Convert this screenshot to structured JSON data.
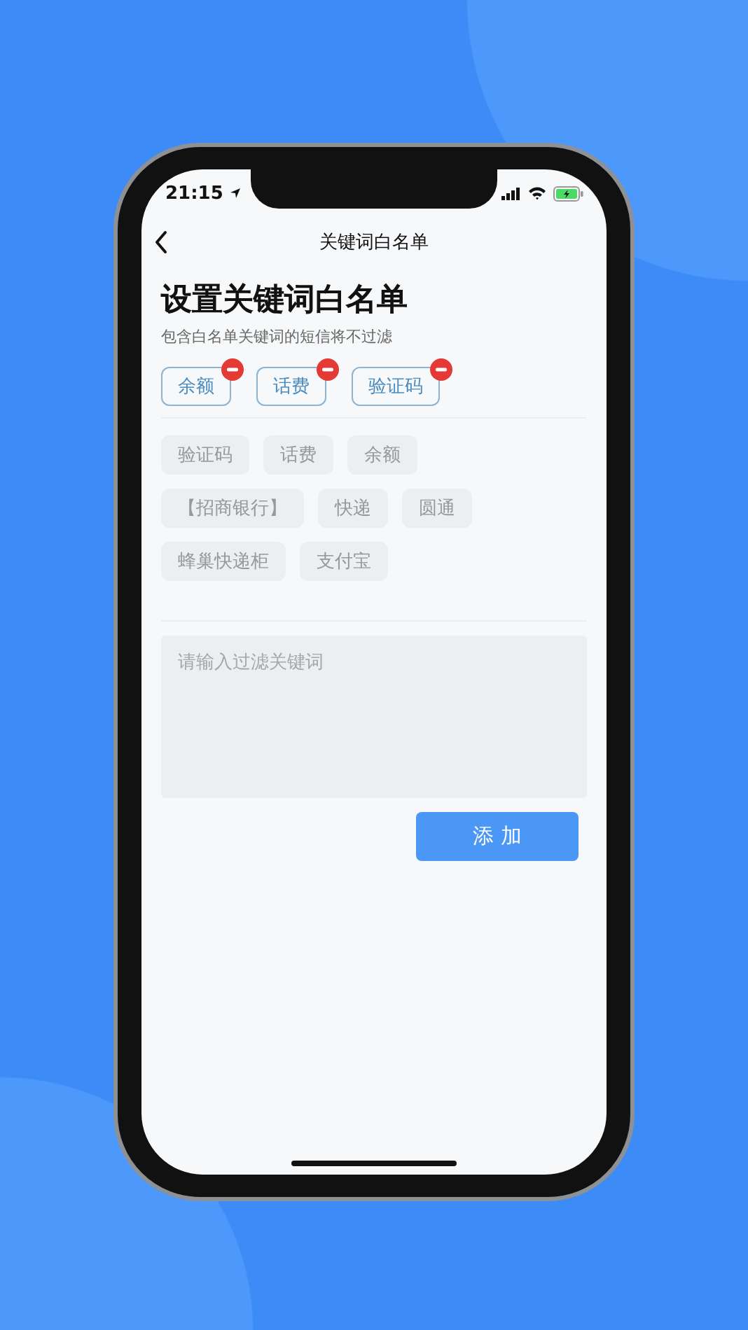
{
  "status_bar": {
    "time": "21:15"
  },
  "nav": {
    "title": "关键词白名单"
  },
  "heading": "设置关键词白名单",
  "subtitle": "包含白名单关键词的短信将不过滤",
  "keywords": [
    {
      "label": "余额"
    },
    {
      "label": "话费"
    },
    {
      "label": "验证码"
    }
  ],
  "suggestions": [
    [
      "验证码",
      "话费",
      "余额"
    ],
    [
      "【招商银行】",
      "快递",
      "圆通"
    ],
    [
      "蜂巢快递柜",
      "支付宝"
    ]
  ],
  "input": {
    "placeholder": "请输入过滤关键词"
  },
  "add_button": "添 加"
}
